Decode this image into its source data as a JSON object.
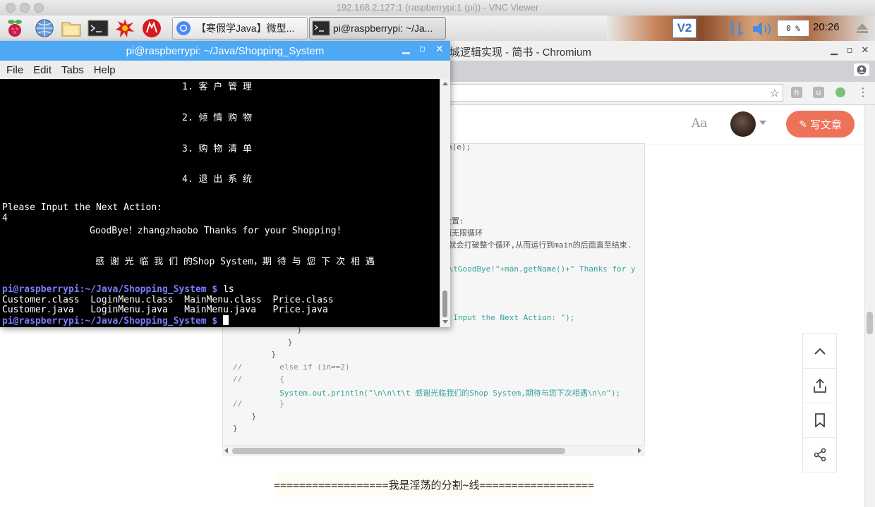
{
  "vnc": {
    "title": "192.168.2.127:1 (raspberrypi:1 (pi)) - VNC Viewer"
  },
  "taskbar": {
    "launchers": [
      "raspberry-menu-icon",
      "globe-browser-icon",
      "file-manager-icon",
      "terminal-icon",
      "burst-icon",
      "wolfram-icon"
    ],
    "tasks": [
      {
        "label": "【寒假学Java】微型...",
        "icon": "chromium-icon"
      },
      {
        "label": "pi@raspberrypi: ~/Ja...",
        "icon": "terminal-icon"
      }
    ],
    "tray": {
      "vnc_label": "V2",
      "cpu": "0 %",
      "clock": "20:26"
    }
  },
  "chromium": {
    "title": "城逻辑实现 - 简书 - Chromium",
    "header": {
      "font_button": "Aa",
      "write_button": "写文章"
    }
  },
  "code_lines": [
    "n(e);",
    "设置:",
    "而无限循环",
    ",就会打破整个循环,从而运行到main的后面直至结束.",
    "t\\tGoodBye!\"+man.getName()+\" Thanks for y",
    "e Input the Next Action: \");",
    "        }",
    "      }",
    "    }",
    "//        else if (in==2)",
    "//        {",
    "          System.out.println(\"\\n\\n\\t\\t 感谢光临我们的Shop System,期待与您下次相遇\\n\\n\");",
    "//        }",
    "    }",
    "}"
  ],
  "divider_text": "==================我是淫荡的分割~线==================",
  "terminal": {
    "title": "pi@raspberrypi: ~/Java/Shopping_System",
    "menu": [
      "File",
      "Edit",
      "Tabs",
      "Help"
    ],
    "lines": {
      "opt1": "1. 客 户 管 理",
      "opt2": "2. 倾 情 购 物",
      "opt3": "3. 购 物 清 单",
      "opt4": "4. 退 出 系 统",
      "ask": "Please Input the Next Action:",
      "input": "4",
      "goodbye": "GoodBye！zhangzhaobo Thanks for your Shopping!",
      "thanks": "感 谢 光 临 我 们 的Shop System，期 待 与 您 下 次 相 遇",
      "prompt_user": "pi@raspberrypi",
      "prompt_path": ":~/Java/Shopping_System $",
      "cmd": " ls",
      "ls1": "Customer.class  LoginMenu.class  MainMenu.class  Price.class",
      "ls2": "Customer.java   LoginMenu.java   MainMenu.java   Price.java"
    }
  },
  "side_tools": [
    "chevron-up-icon",
    "share-upload-icon",
    "bookmark-icon",
    "share-nodes-icon"
  ]
}
